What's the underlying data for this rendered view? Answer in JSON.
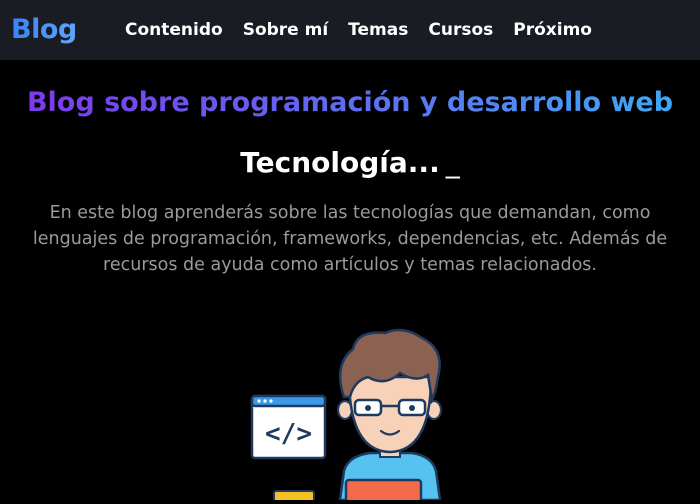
{
  "navbar": {
    "brand": "Blog",
    "links": [
      "Contenido",
      "Sobre mí",
      "Temas",
      "Cursos",
      "Próximo"
    ]
  },
  "hero": {
    "title": "Blog sobre programación y desarrollo web",
    "subtitle": "Tecnología...",
    "cursor": "_",
    "description": "En este blog aprenderás sobre las tecnologías que demandan, como lenguajes de programación, frameworks, dependencias, etc. Además de recursos de ayuda como artículos y temas relacionados."
  },
  "illustration": {
    "code_window_text": "</>"
  },
  "colors": {
    "background": "#000000",
    "navbar": "#191c22",
    "brand_gradient": [
      "#3b82f6",
      "#60a5fa"
    ],
    "title_gradient": [
      "#7c3aed",
      "#6366f1",
      "#3ea8f5"
    ],
    "description": "#9a9a9a"
  }
}
